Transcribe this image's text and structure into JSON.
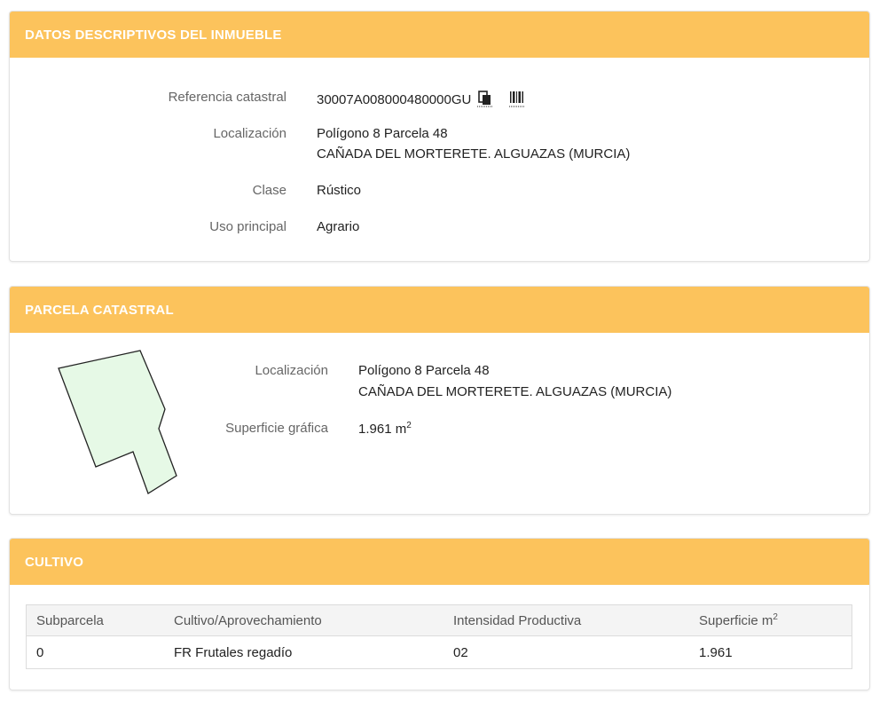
{
  "sections": {
    "datos": {
      "title": "DATOS DESCRIPTIVOS DEL INMUEBLE",
      "rows": {
        "referencia": {
          "label": "Referencia catastral",
          "value": "30007A008000480000GU"
        },
        "localizacion": {
          "label": "Localización",
          "line1": "Polígono 8 Parcela 48",
          "line2": "CAÑADA DEL MORTERETE. ALGUAZAS (MURCIA)"
        },
        "clase": {
          "label": "Clase",
          "value": "Rústico"
        },
        "uso": {
          "label": "Uso principal",
          "value": "Agrario"
        }
      },
      "icons": [
        "copy-icon",
        "barcode-icon"
      ]
    },
    "parcela": {
      "title": "PARCELA CATASTRAL",
      "localizacion": {
        "label": "Localización",
        "line1": "Polígono 8 Parcela 48",
        "line2": "CAÑADA DEL MORTERETE. ALGUAZAS (MURCIA)"
      },
      "superficie": {
        "label": "Superficie gráfica",
        "value": "1.961 m",
        "unit_sup": "2"
      },
      "shape_fill": "#e6f9e6"
    },
    "cultivo": {
      "title": "CULTIVO",
      "headers": {
        "subparcela": "Subparcela",
        "cultivo": "Cultivo/Aprovechamiento",
        "intensidad": "Intensidad Productiva",
        "superficie": "Superficie m",
        "superficie_sup": "2"
      },
      "rows": [
        {
          "subparcela": "0",
          "cultivo": "FR Frutales regadío",
          "intensidad": "02",
          "superficie": "1.961"
        }
      ]
    }
  },
  "colors": {
    "header": "#fcc35c",
    "header_text": "#ffffff",
    "label": "#666666"
  }
}
